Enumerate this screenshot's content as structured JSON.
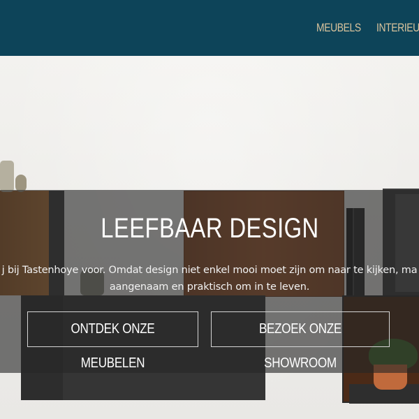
{
  "header": {
    "nav": [
      {
        "label": "MEUBELS"
      },
      {
        "label": "INTERIEUR"
      }
    ],
    "colors": {
      "background": "#0d4459",
      "nav_text": "#d9c39c"
    }
  },
  "hero": {
    "title": "LEEFBAAR DESIGN",
    "description_line1": "j bij Tastenhoye voor. Omdat design niet enkel mooi moet zijn om naar te kijken, ma",
    "description_line2": "aangenaam en praktisch om in te leven.",
    "buttons": {
      "discover": "ONTDEK ONZE MEUBELEN",
      "showroom": "BEZOEK ONZE SHOWROOM"
    },
    "overlay_color": "#262626"
  }
}
